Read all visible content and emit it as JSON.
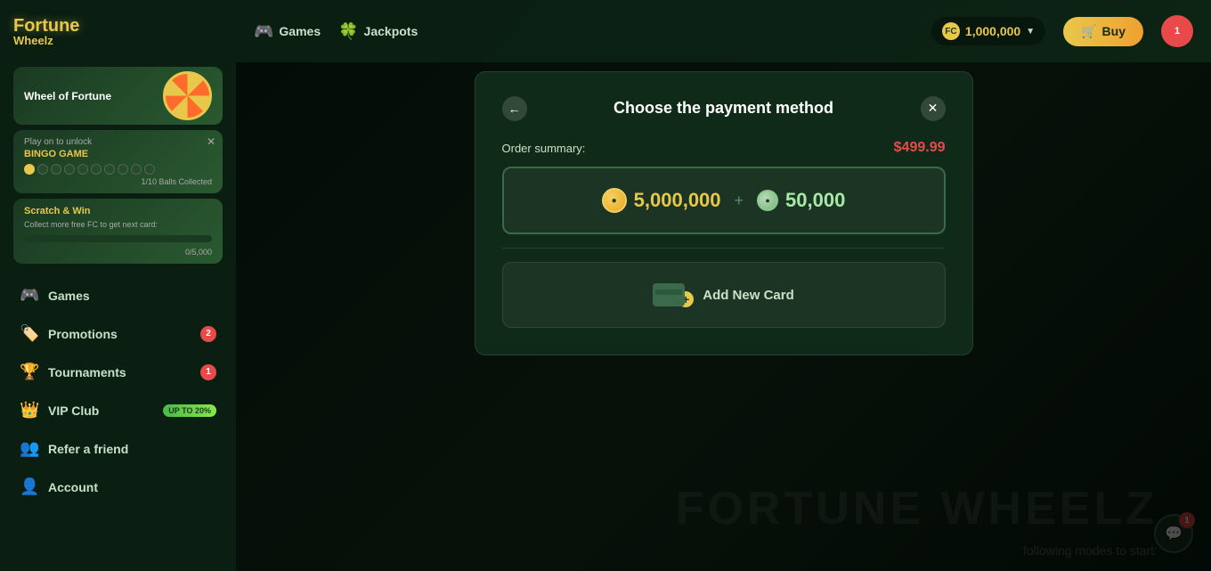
{
  "app": {
    "name": "FortuneWheelz",
    "logo_line1": "Fortune",
    "logo_line2": "Wheelz"
  },
  "topnav": {
    "items": [
      {
        "label": "Games",
        "icon": "🎮"
      },
      {
        "label": "Jackpots",
        "icon": "🍀"
      }
    ],
    "balance": {
      "icon": "FC",
      "amount": "1,000,000",
      "chevron": "▼"
    },
    "buy_label": "Buy"
  },
  "sidebar": {
    "promo_cards": {
      "wheel": {
        "label": "Wheel of Fortune"
      },
      "bingo": {
        "play_text": "Play on to unlock",
        "game_name": "BINGO GAME",
        "dots_filled": 1,
        "dots_total": 10,
        "progress_text": "1/10 Balls Collected"
      },
      "scratch": {
        "title": "Scratch & Win",
        "desc": "Collect more free FC to get next card:",
        "progress": "0/5,000",
        "fill_pct": 0
      }
    },
    "nav_items": [
      {
        "id": "games",
        "label": "Games",
        "icon": "🎮",
        "badge": null
      },
      {
        "id": "promotions",
        "label": "Promotions",
        "icon": "🏷️",
        "badge": "2"
      },
      {
        "id": "tournaments",
        "label": "Tournaments",
        "icon": "🏆",
        "badge": "1"
      },
      {
        "id": "vip-club",
        "label": "VIP Club",
        "icon": "👑",
        "badge_up": "UP TO 20%"
      },
      {
        "id": "refer-a-friend",
        "label": "Refer a friend",
        "icon": "👤",
        "badge": null
      },
      {
        "id": "account",
        "label": "Account",
        "icon": "👤",
        "badge": null
      }
    ]
  },
  "modal": {
    "title": "Choose the payment method",
    "back_button": "←",
    "close_button": "✕",
    "order_summary_label": "Order summary:",
    "order_price": "$499.99",
    "package": {
      "gold_coins": "5,000,000",
      "silver_coins": "50,000"
    },
    "add_card_label": "Add New Card"
  },
  "background": {
    "text1": "FORTUNE WHEELZ",
    "text2": "following modes to start:"
  },
  "chat": {
    "badge": "1",
    "icon": "💬"
  },
  "rank": {
    "badge": "1",
    "icon": "🏆"
  }
}
